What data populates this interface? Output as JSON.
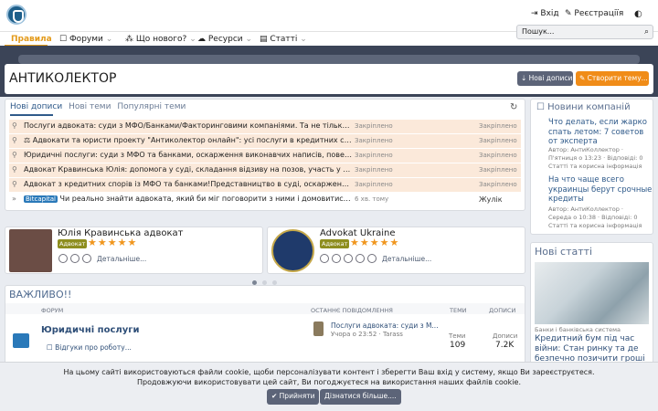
{
  "header": {
    "login": "Вхід",
    "register": "Реєстраціїя"
  },
  "nav": {
    "items": [
      "Правила",
      "Форуми",
      "Що нового?",
      "Ресурси",
      "Статті"
    ]
  },
  "search": {
    "placeholder": "Пошук..."
  },
  "page": {
    "title": "АНТИКОЛЕКТОР",
    "new_posts_btn": "Нові дописи",
    "create_thread_btn": "Створити тему..."
  },
  "tabs": [
    "Нові дописи",
    "Нові теми",
    "Популярні теми"
  ],
  "threads": [
    {
      "title": "Послуги адвоката: суди з МФО/Банками/Факторинговими компаніями. Та не тільки))) П...",
      "status": "Закріплено",
      "status2": "Закріплено"
    },
    {
      "title": "⚖ Адвокати та юристи проекту \"Антиколектор онлайн\": усі послуги в кредитних справах",
      "status": "Закріплено",
      "status2": "Закріплено"
    },
    {
      "title": "Юридичні послуги: суди з МФО та банками, оскарження виконавчих написів, повернен...",
      "status": "Закріплено",
      "status2": "Закріплено"
    },
    {
      "title": "Адвокат Кравинська Юлія: допомога у суді, складання відзиву на позов, участь у судов...",
      "status": "Закріплено",
      "status2": "Закріплено"
    },
    {
      "title": "Адвокат з кредитних спорів із МФО та банками!Представництво в суді, оскарження ...",
      "status": "Закріплено",
      "status2": "Закріплено"
    },
    {
      "badge": "Bitcapital",
      "title": "Чи реально знайти адвоката, який би міг поговорити з ними і домовитись п...",
      "status": "6 хв. тому",
      "status2": "Жулік"
    }
  ],
  "lawyers": [
    {
      "name": "Юлія Кравинська адвокат",
      "tag": "Адвокат",
      "details": "Детальніше..."
    },
    {
      "name": "Advokat Ukraine",
      "tag": "Адвокат",
      "details": "Детальніше..."
    }
  ],
  "important": {
    "title": "ВАЖЛИВО!!",
    "col_forum": "ФОРУМ",
    "col_last": "ОСТАННЄ ПОВІДОМЛЕННЯ",
    "col_threads": "ТЕМИ",
    "col_posts": "ДОПИСИ",
    "forum_name": "Юридичні послуги",
    "sub_forum": "Відгуки про роботу...",
    "last_title": "Послуги адвоката: суди з М...",
    "last_time": "Учора о 23:52",
    "last_user": "Tarass",
    "threads_label": "Теми",
    "threads_count": "109",
    "posts_label": "Дописи",
    "posts_count": "7.2K"
  },
  "sidebar": {
    "companies_title": "Новини компаній",
    "items": [
      {
        "title": "Что делать, если жарко спать летом: 7 советов от эксперта",
        "meta1": "Автор: АнтиКоллектор ·",
        "meta2": "П'ятниця о 13:23 · Відповіді: 0",
        "meta3": "Статті та корисна інформація"
      },
      {
        "title": "На что чаще всего украинцы берут срочные кредиты",
        "meta1": "Автор: АнтиКоллектор ·",
        "meta2": "Середа о 10:38 · Відповіді: 0",
        "meta3": "Статті та корисна інформація"
      }
    ],
    "articles_title": "Нові статті",
    "article_cat": "Банки і банківська система",
    "article_title": "Кредитний бум під час війни: Стан ринку та де безпечно позичити гроші в Україні"
  },
  "cookie": {
    "line1": "На цьому сайті використовуються файли cookie, щоби персоналізувати контент і зберегти Ваш вхід у систему, якщо Ви зареєструєтеся.",
    "line2": "Продовжуючи використовувати цей сайт, Ви погоджуєтеся на використання наших файлів cookie.",
    "accept": "Прийняти",
    "more": "Дізнатися більше...."
  }
}
